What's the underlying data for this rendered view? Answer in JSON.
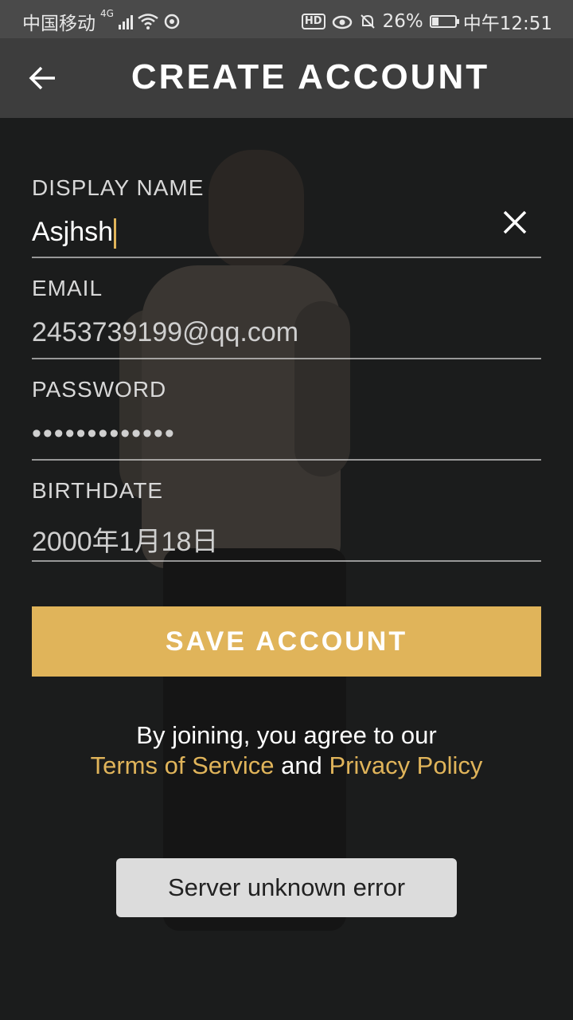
{
  "status_bar": {
    "carrier": "中国移动",
    "network": "4G",
    "battery": "26%",
    "time": "中午12:51",
    "hd_badge": "HD"
  },
  "header": {
    "title": "CREATE ACCOUNT",
    "back_icon": "back-arrow-icon"
  },
  "form": {
    "display_name": {
      "label": "DISPLAY NAME",
      "value": "Asjhsh"
    },
    "email": {
      "label": "EMAIL",
      "value": "2453739199@qq.com"
    },
    "password": {
      "label": "PASSWORD",
      "value": "•••••••••••••"
    },
    "birthdate": {
      "label": "BIRTHDATE",
      "value": "2000年1月18日"
    }
  },
  "actions": {
    "save_label": "SAVE ACCOUNT"
  },
  "terms": {
    "prefix": "By joining, you agree to our",
    "terms_link": "Terms of Service",
    "conjunction": "and",
    "privacy_link": "Privacy Policy"
  },
  "toast": {
    "message": "Server unknown error"
  },
  "colors": {
    "accent": "#e0b45a",
    "header_bg": "#3d3d3d",
    "status_bg": "#4a4a4a",
    "page_bg": "#1b1c1c"
  }
}
